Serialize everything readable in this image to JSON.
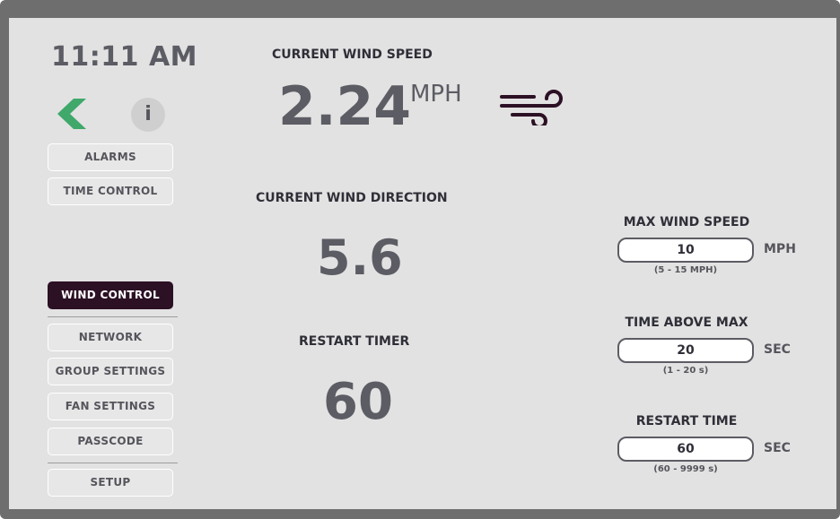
{
  "clock": {
    "time": "11:11 AM"
  },
  "icons": {
    "back": "back-arrow-icon",
    "info": "info-icon",
    "wind": "wind-icon"
  },
  "header": {
    "info_glyph": "i"
  },
  "nav": {
    "alarms": "ALARMS",
    "time_control": "TIME CONTROL",
    "wind_control": "WIND CONTROL",
    "network": "NETWORK",
    "group_settings": "GROUP SETTINGS",
    "fan_settings": "FAN SETTINGS",
    "passcode": "PASSCODE",
    "setup": "SETUP"
  },
  "readouts": {
    "wind_speed_label": "CURRENT WIND SPEED",
    "wind_speed_value": "2.24",
    "wind_speed_unit": "MPH",
    "wind_direction_label": "CURRENT WIND DIRECTION",
    "wind_direction_value": "5.6",
    "restart_timer_label": "RESTART TIMER",
    "restart_timer_value": "60"
  },
  "settings": {
    "max_wind_speed": {
      "label": "MAX WIND SPEED",
      "value": "10",
      "unit": "MPH",
      "range": "(5 - 15 MPH)"
    },
    "time_above_max": {
      "label": "TIME ABOVE MAX",
      "value": "20",
      "unit": "SEC",
      "range": "(1 - 20 s)"
    },
    "restart_time": {
      "label": "RESTART TIME",
      "value": "60",
      "unit": "SEC",
      "range": "(60 - 9999 s)"
    }
  },
  "colors": {
    "accent_green": "#3fa86a",
    "active_nav": "#2c1024",
    "wind_icon": "#2c1024"
  }
}
